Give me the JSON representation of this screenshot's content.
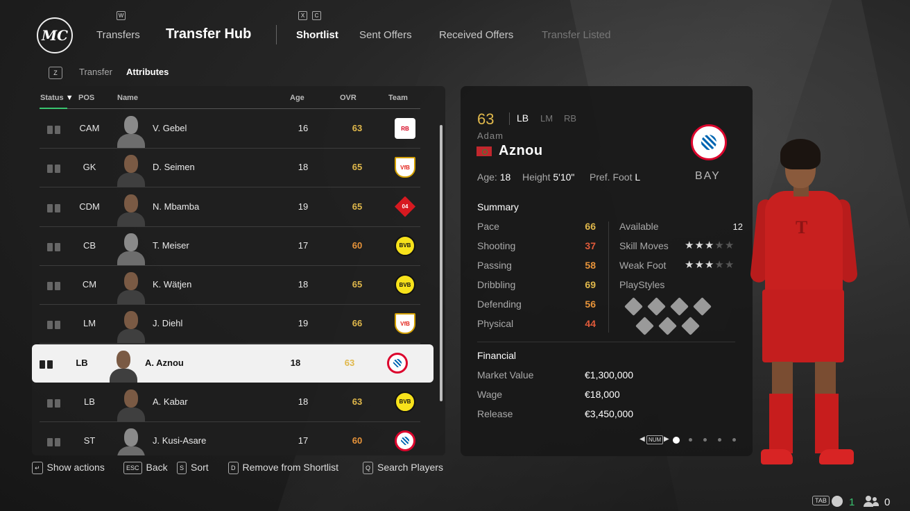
{
  "logo": {
    "text": "MC"
  },
  "nav": {
    "w_key": "W",
    "x_key": "X",
    "c_key": "C",
    "transfers": "Transfers",
    "hub": "Transfer Hub",
    "tabs": [
      "Shortlist",
      "Sent Offers",
      "Received Offers",
      "Transfer Listed"
    ],
    "active_tab": "Shortlist"
  },
  "subnav": {
    "z_key": "Z",
    "items": [
      "Transfer",
      "Attributes"
    ],
    "active": "Attributes"
  },
  "table": {
    "columns": [
      "Status",
      "POS",
      "Name",
      "Age",
      "OVR",
      "Team"
    ],
    "sort_column": "Status",
    "rows": [
      {
        "pos": "CAM",
        "name": "V. Gebel",
        "age": "16",
        "ovr": "63",
        "ovr_color": "#e0b84b",
        "team": "RB Leipzig",
        "crest": "rb",
        "photo": "silhouette"
      },
      {
        "pos": "GK",
        "name": "D. Seimen",
        "age": "18",
        "ovr": "65",
        "ovr_color": "#e0b84b",
        "team": "VfB Stuttgart",
        "crest": "vfb",
        "photo": "face"
      },
      {
        "pos": "CDM",
        "name": "N. Mbamba",
        "age": "19",
        "ovr": "65",
        "ovr_color": "#e0b84b",
        "team": "Bayer 04",
        "crest": "b04",
        "photo": "face"
      },
      {
        "pos": "CB",
        "name": "T. Meiser",
        "age": "17",
        "ovr": "60",
        "ovr_color": "#e8943a",
        "team": "Borussia Dortmund",
        "crest": "bvb",
        "photo": "silhouette"
      },
      {
        "pos": "CM",
        "name": "K. Wätjen",
        "age": "18",
        "ovr": "65",
        "ovr_color": "#e0b84b",
        "team": "Borussia Dortmund",
        "crest": "bvb",
        "photo": "face"
      },
      {
        "pos": "LM",
        "name": "J. Diehl",
        "age": "19",
        "ovr": "66",
        "ovr_color": "#e0b84b",
        "team": "VfB Stuttgart",
        "crest": "vfb",
        "photo": "face"
      },
      {
        "pos": "LB",
        "name": "A. Aznou",
        "age": "18",
        "ovr": "63",
        "ovr_color": "#e0b84b",
        "team": "FC Bayern München",
        "crest": "fcb",
        "photo": "face",
        "selected": true
      },
      {
        "pos": "LB",
        "name": "A. Kabar",
        "age": "18",
        "ovr": "63",
        "ovr_color": "#e0b84b",
        "team": "Borussia Dortmund",
        "crest": "bvb",
        "photo": "face"
      },
      {
        "pos": "ST",
        "name": "J. Kusi-Asare",
        "age": "17",
        "ovr": "60",
        "ovr_color": "#e8943a",
        "team": "FC Bayern München",
        "crest": "fcb",
        "photo": "silhouette"
      }
    ]
  },
  "hints": [
    {
      "key": "↵",
      "label": "Show actions"
    },
    {
      "key": "ESC",
      "label": "Back"
    },
    {
      "key": "S",
      "label": "Sort"
    },
    {
      "key": "D",
      "label": "Remove from Shortlist"
    },
    {
      "key": "Q",
      "label": "Search Players"
    }
  ],
  "player": {
    "ovr": "63",
    "positions": [
      "LB",
      "LM",
      "RB"
    ],
    "first_name": "Adam",
    "last_name": "Aznou",
    "nationality_flag": "Morocco",
    "club_abbr": "BAY",
    "age_label": "Age:",
    "age": "18",
    "height_label": "Height",
    "height": "5'10\"",
    "foot_label": "Pref. Foot",
    "foot": "L",
    "summary_title": "Summary",
    "stats": [
      {
        "label": "Pace",
        "value": "66",
        "color": "#e0b84b"
      },
      {
        "label": "Shooting",
        "value": "37",
        "color": "#e05a3a"
      },
      {
        "label": "Passing",
        "value": "58",
        "color": "#e8943a"
      },
      {
        "label": "Dribbling",
        "value": "69",
        "color": "#e0b84b"
      },
      {
        "label": "Defending",
        "value": "56",
        "color": "#e8943a"
      },
      {
        "label": "Physical",
        "value": "44",
        "color": "#e05a3a"
      }
    ],
    "available_label": "Available",
    "available": "12",
    "skill_moves_label": "Skill Moves",
    "skill_moves": 3,
    "weak_foot_label": "Weak Foot",
    "weak_foot": 3,
    "playstyles_label": "PlayStyles",
    "financial_title": "Financial",
    "financial": [
      {
        "label": "Market Value",
        "value": "€1,300,000"
      },
      {
        "label": "Wage",
        "value": "€18,000"
      },
      {
        "label": "Release",
        "value": "€3,450,000"
      }
    ],
    "pager_key": "NUM",
    "pages": 5,
    "current_page": 1
  },
  "status": {
    "tab_key": "TAB",
    "voice_count": "1",
    "users_count": "0"
  },
  "colors": {
    "accent_green": "#39c46f",
    "ovr_gold": "#e0b84b",
    "ovr_orange": "#e8943a",
    "ovr_red": "#e05a3a"
  }
}
